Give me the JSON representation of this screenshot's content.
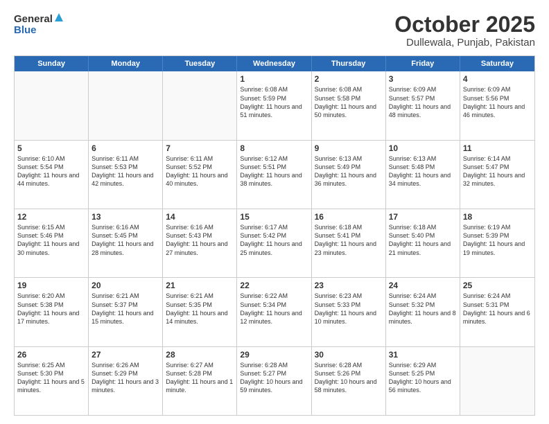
{
  "header": {
    "logo_general": "General",
    "logo_blue": "Blue",
    "title": "October 2025",
    "subtitle": "Dullewala, Punjab, Pakistan"
  },
  "weekdays": [
    "Sunday",
    "Monday",
    "Tuesday",
    "Wednesday",
    "Thursday",
    "Friday",
    "Saturday"
  ],
  "weeks": [
    [
      {
        "day": "",
        "sunrise": "",
        "sunset": "",
        "daylight": ""
      },
      {
        "day": "",
        "sunrise": "",
        "sunset": "",
        "daylight": ""
      },
      {
        "day": "",
        "sunrise": "",
        "sunset": "",
        "daylight": ""
      },
      {
        "day": "1",
        "sunrise": "Sunrise: 6:08 AM",
        "sunset": "Sunset: 5:59 PM",
        "daylight": "Daylight: 11 hours and 51 minutes."
      },
      {
        "day": "2",
        "sunrise": "Sunrise: 6:08 AM",
        "sunset": "Sunset: 5:58 PM",
        "daylight": "Daylight: 11 hours and 50 minutes."
      },
      {
        "day": "3",
        "sunrise": "Sunrise: 6:09 AM",
        "sunset": "Sunset: 5:57 PM",
        "daylight": "Daylight: 11 hours and 48 minutes."
      },
      {
        "day": "4",
        "sunrise": "Sunrise: 6:09 AM",
        "sunset": "Sunset: 5:56 PM",
        "daylight": "Daylight: 11 hours and 46 minutes."
      }
    ],
    [
      {
        "day": "5",
        "sunrise": "Sunrise: 6:10 AM",
        "sunset": "Sunset: 5:54 PM",
        "daylight": "Daylight: 11 hours and 44 minutes."
      },
      {
        "day": "6",
        "sunrise": "Sunrise: 6:11 AM",
        "sunset": "Sunset: 5:53 PM",
        "daylight": "Daylight: 11 hours and 42 minutes."
      },
      {
        "day": "7",
        "sunrise": "Sunrise: 6:11 AM",
        "sunset": "Sunset: 5:52 PM",
        "daylight": "Daylight: 11 hours and 40 minutes."
      },
      {
        "day": "8",
        "sunrise": "Sunrise: 6:12 AM",
        "sunset": "Sunset: 5:51 PM",
        "daylight": "Daylight: 11 hours and 38 minutes."
      },
      {
        "day": "9",
        "sunrise": "Sunrise: 6:13 AM",
        "sunset": "Sunset: 5:49 PM",
        "daylight": "Daylight: 11 hours and 36 minutes."
      },
      {
        "day": "10",
        "sunrise": "Sunrise: 6:13 AM",
        "sunset": "Sunset: 5:48 PM",
        "daylight": "Daylight: 11 hours and 34 minutes."
      },
      {
        "day": "11",
        "sunrise": "Sunrise: 6:14 AM",
        "sunset": "Sunset: 5:47 PM",
        "daylight": "Daylight: 11 hours and 32 minutes."
      }
    ],
    [
      {
        "day": "12",
        "sunrise": "Sunrise: 6:15 AM",
        "sunset": "Sunset: 5:46 PM",
        "daylight": "Daylight: 11 hours and 30 minutes."
      },
      {
        "day": "13",
        "sunrise": "Sunrise: 6:16 AM",
        "sunset": "Sunset: 5:45 PM",
        "daylight": "Daylight: 11 hours and 28 minutes."
      },
      {
        "day": "14",
        "sunrise": "Sunrise: 6:16 AM",
        "sunset": "Sunset: 5:43 PM",
        "daylight": "Daylight: 11 hours and 27 minutes."
      },
      {
        "day": "15",
        "sunrise": "Sunrise: 6:17 AM",
        "sunset": "Sunset: 5:42 PM",
        "daylight": "Daylight: 11 hours and 25 minutes."
      },
      {
        "day": "16",
        "sunrise": "Sunrise: 6:18 AM",
        "sunset": "Sunset: 5:41 PM",
        "daylight": "Daylight: 11 hours and 23 minutes."
      },
      {
        "day": "17",
        "sunrise": "Sunrise: 6:18 AM",
        "sunset": "Sunset: 5:40 PM",
        "daylight": "Daylight: 11 hours and 21 minutes."
      },
      {
        "day": "18",
        "sunrise": "Sunrise: 6:19 AM",
        "sunset": "Sunset: 5:39 PM",
        "daylight": "Daylight: 11 hours and 19 minutes."
      }
    ],
    [
      {
        "day": "19",
        "sunrise": "Sunrise: 6:20 AM",
        "sunset": "Sunset: 5:38 PM",
        "daylight": "Daylight: 11 hours and 17 minutes."
      },
      {
        "day": "20",
        "sunrise": "Sunrise: 6:21 AM",
        "sunset": "Sunset: 5:37 PM",
        "daylight": "Daylight: 11 hours and 15 minutes."
      },
      {
        "day": "21",
        "sunrise": "Sunrise: 6:21 AM",
        "sunset": "Sunset: 5:35 PM",
        "daylight": "Daylight: 11 hours and 14 minutes."
      },
      {
        "day": "22",
        "sunrise": "Sunrise: 6:22 AM",
        "sunset": "Sunset: 5:34 PM",
        "daylight": "Daylight: 11 hours and 12 minutes."
      },
      {
        "day": "23",
        "sunrise": "Sunrise: 6:23 AM",
        "sunset": "Sunset: 5:33 PM",
        "daylight": "Daylight: 11 hours and 10 minutes."
      },
      {
        "day": "24",
        "sunrise": "Sunrise: 6:24 AM",
        "sunset": "Sunset: 5:32 PM",
        "daylight": "Daylight: 11 hours and 8 minutes."
      },
      {
        "day": "25",
        "sunrise": "Sunrise: 6:24 AM",
        "sunset": "Sunset: 5:31 PM",
        "daylight": "Daylight: 11 hours and 6 minutes."
      }
    ],
    [
      {
        "day": "26",
        "sunrise": "Sunrise: 6:25 AM",
        "sunset": "Sunset: 5:30 PM",
        "daylight": "Daylight: 11 hours and 5 minutes."
      },
      {
        "day": "27",
        "sunrise": "Sunrise: 6:26 AM",
        "sunset": "Sunset: 5:29 PM",
        "daylight": "Daylight: 11 hours and 3 minutes."
      },
      {
        "day": "28",
        "sunrise": "Sunrise: 6:27 AM",
        "sunset": "Sunset: 5:28 PM",
        "daylight": "Daylight: 11 hours and 1 minute."
      },
      {
        "day": "29",
        "sunrise": "Sunrise: 6:28 AM",
        "sunset": "Sunset: 5:27 PM",
        "daylight": "Daylight: 10 hours and 59 minutes."
      },
      {
        "day": "30",
        "sunrise": "Sunrise: 6:28 AM",
        "sunset": "Sunset: 5:26 PM",
        "daylight": "Daylight: 10 hours and 58 minutes."
      },
      {
        "day": "31",
        "sunrise": "Sunrise: 6:29 AM",
        "sunset": "Sunset: 5:25 PM",
        "daylight": "Daylight: 10 hours and 56 minutes."
      },
      {
        "day": "",
        "sunrise": "",
        "sunset": "",
        "daylight": ""
      }
    ]
  ]
}
